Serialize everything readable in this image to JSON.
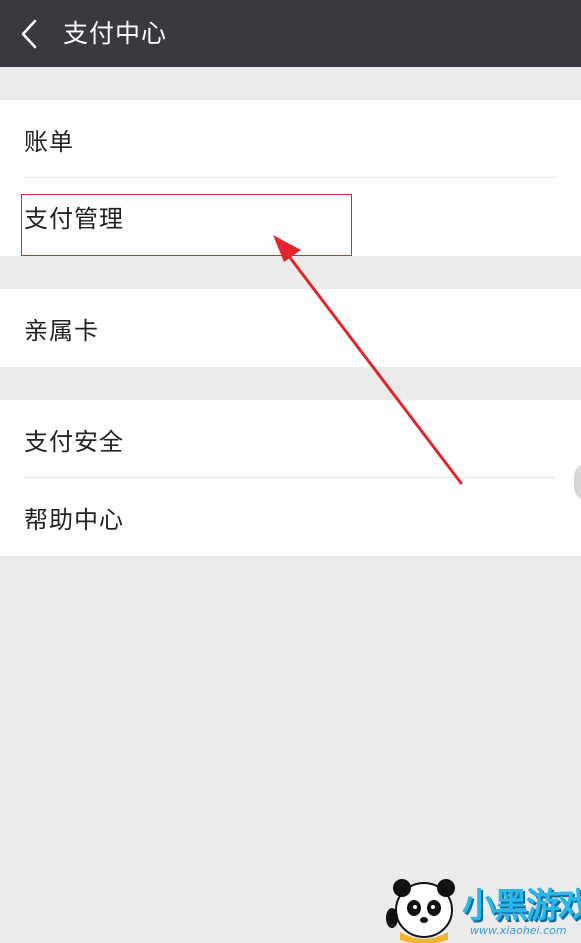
{
  "header": {
    "title": "支付中心",
    "back_icon": "chevron-left-icon"
  },
  "groups": [
    {
      "items": [
        {
          "label": "账单"
        },
        {
          "label": "支付管理",
          "highlighted": true
        }
      ]
    },
    {
      "items": [
        {
          "label": "亲属卡"
        }
      ]
    },
    {
      "items": [
        {
          "label": "支付安全"
        },
        {
          "label": "帮助中心"
        }
      ]
    }
  ],
  "annotation": {
    "color": "#e0262c",
    "target": "支付管理"
  },
  "watermark": {
    "brand": "小黑游戏",
    "url": "www.xiaohei.com"
  },
  "colors": {
    "topbar": "#393a3f",
    "background": "#ebebeb",
    "row_background": "#ffffff",
    "text": "#222222"
  }
}
